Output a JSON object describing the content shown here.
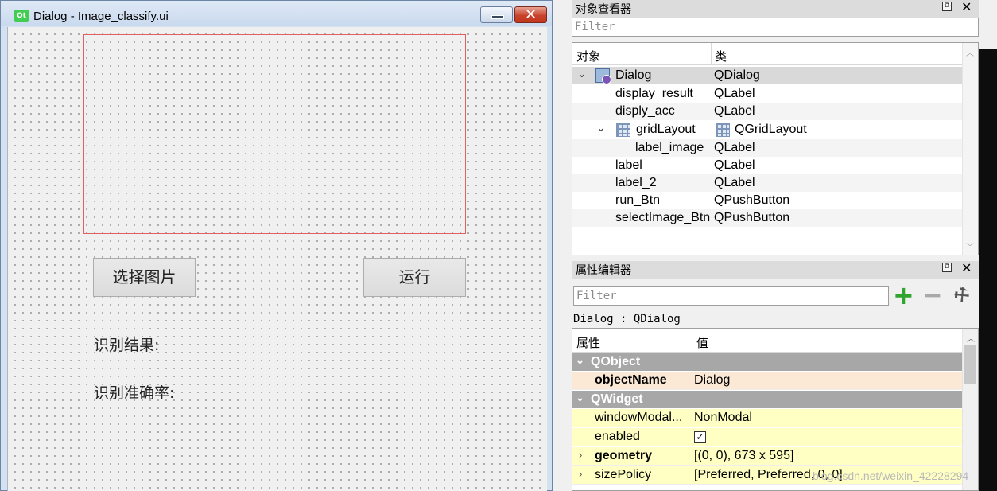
{
  "form_window": {
    "title": "Dialog - Image_classify.ui",
    "logo": "Qt",
    "close_glyph": "✕",
    "buttons": {
      "select_image": "选择图片",
      "run": "运行"
    },
    "labels": {
      "result": "识别结果:",
      "accuracy": "识别准确率:"
    }
  },
  "object_inspector": {
    "title": "对象查看器",
    "filter_placeholder": "Filter",
    "columns": [
      "对象",
      "类"
    ],
    "rows": [
      {
        "name": "Dialog",
        "class": "QDialog",
        "icon": "dialog-icon",
        "expanded": true,
        "selected": true
      },
      {
        "name": "display_result",
        "class": "QLabel"
      },
      {
        "name": "disply_acc",
        "class": "QLabel"
      },
      {
        "name": "gridLayout",
        "class": "QGridLayout",
        "icon": "grid-layout-icon",
        "expanded": true
      },
      {
        "name": "label_image",
        "class": "QLabel"
      },
      {
        "name": "label",
        "class": "QLabel"
      },
      {
        "name": "label_2",
        "class": "QLabel"
      },
      {
        "name": "run_Btn",
        "class": "QPushButton"
      },
      {
        "name": "selectImage_Btn",
        "class": "QPushButton"
      }
    ]
  },
  "property_editor": {
    "title": "属性编辑器",
    "filter_placeholder": "Filter",
    "object_info": "Dialog : QDialog",
    "columns": [
      "属性",
      "值"
    ],
    "groups": [
      {
        "name": "QObject",
        "properties": [
          {
            "name": "objectName",
            "value": "Dialog"
          }
        ]
      },
      {
        "name": "QWidget",
        "properties": [
          {
            "name": "windowModal...",
            "value": "NonModal"
          },
          {
            "name": "enabled",
            "value": "checked"
          },
          {
            "name": "geometry",
            "value": "[(0, 0), 673 x 595]"
          },
          {
            "name": "sizePolicy",
            "value": "[Preferred, Preferred, 0, 0]"
          }
        ]
      }
    ]
  },
  "watermark": "blog.csdn.net/weixin_42228294",
  "colors": {
    "group_header": "#a7a7a7",
    "qobject_row": "#fbe9d5",
    "qwidget_row": "#ffffc4",
    "image_border": "#e06060"
  }
}
